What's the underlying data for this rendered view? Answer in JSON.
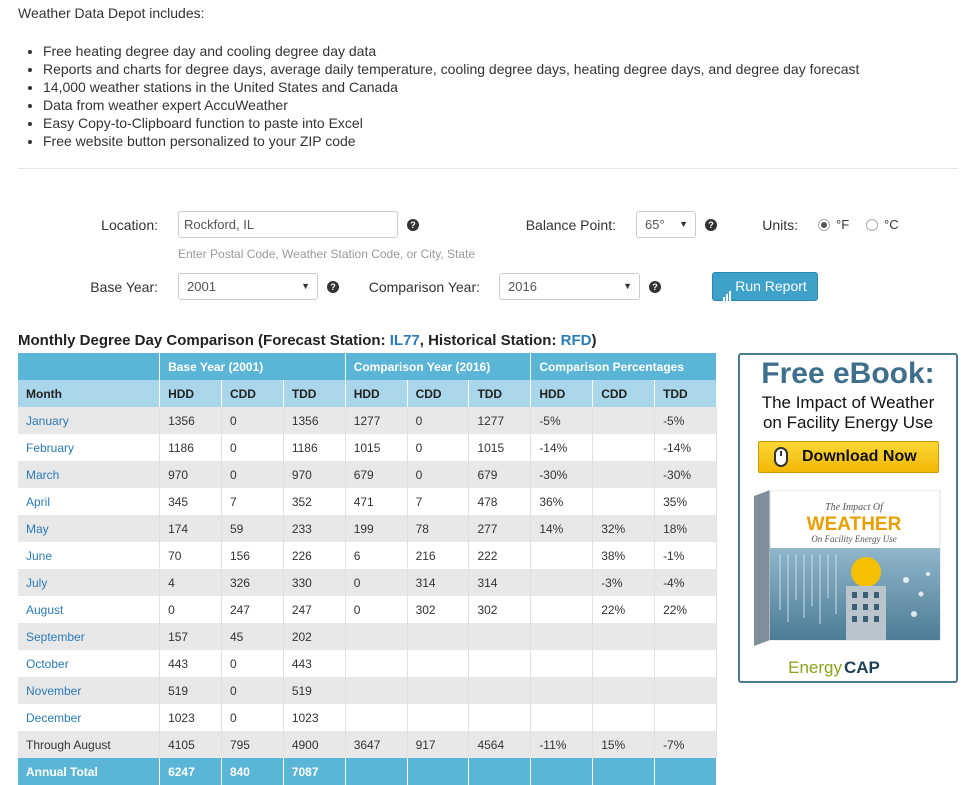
{
  "intro": {
    "title": "Weather Data Depot includes:",
    "bullets": [
      "Free heating degree day and cooling degree day data",
      "Reports and charts for degree days, average daily temperature, cooling degree days, heating degree days, and degree day forecast",
      "14,000 weather stations in the United States and Canada",
      "Data from weather expert AccuWeather",
      "Easy Copy-to-Clipboard function to paste into Excel",
      "Free website button personalized to your ZIP code"
    ]
  },
  "form": {
    "location_label": "Location:",
    "location_value": "Rockford, IL",
    "location_hint": "Enter Postal Code, Weather Station Code, or City, State",
    "balance_label": "Balance Point:",
    "balance_value": "65°",
    "units_label": "Units:",
    "unit_f": "°F",
    "unit_c": "°C",
    "base_year_label": "Base Year:",
    "base_year_value": "2001",
    "comparison_year_label": "Comparison Year:",
    "comparison_year_value": "2016",
    "run_button": "Run Report",
    "help_glyph": "?",
    "caret_glyph": "▼"
  },
  "report": {
    "title_prefix": "Monthly Degree Day Comparison (Forecast Station: ",
    "forecast_station": "IL77",
    "title_mid": ", Historical Station: ",
    "historical_station": "RFD",
    "title_suffix": ")",
    "group_headers": [
      "Base Year (2001)",
      "Comparison Year (2016)",
      "Comparison Percentages"
    ],
    "month_header": "Month",
    "sub_headers": [
      "HDD",
      "CDD",
      "TDD",
      "HDD",
      "CDD",
      "TDD",
      "HDD",
      "CDD",
      "TDD"
    ],
    "rows": [
      [
        "January",
        "1356",
        "0",
        "1356",
        "1277",
        "0",
        "1277",
        "-5%",
        "",
        "-5%"
      ],
      [
        "February",
        "1186",
        "0",
        "1186",
        "1015",
        "0",
        "1015",
        "-14%",
        "",
        "-14%"
      ],
      [
        "March",
        "970",
        "0",
        "970",
        "679",
        "0",
        "679",
        "-30%",
        "",
        "-30%"
      ],
      [
        "April",
        "345",
        "7",
        "352",
        "471",
        "7",
        "478",
        "36%",
        "",
        "35%"
      ],
      [
        "May",
        "174",
        "59",
        "233",
        "199",
        "78",
        "277",
        "14%",
        "32%",
        "18%"
      ],
      [
        "June",
        "70",
        "156",
        "226",
        "6",
        "216",
        "222",
        "",
        "38%",
        "-1%"
      ],
      [
        "July",
        "4",
        "326",
        "330",
        "0",
        "314",
        "314",
        "",
        "-3%",
        "-4%"
      ],
      [
        "August",
        "0",
        "247",
        "247",
        "0",
        "302",
        "302",
        "",
        "22%",
        "22%"
      ],
      [
        "September",
        "157",
        "45",
        "202",
        "",
        "",
        "",
        "",
        "",
        ""
      ],
      [
        "October",
        "443",
        "0",
        "443",
        "",
        "",
        "",
        "",
        "",
        ""
      ],
      [
        "November",
        "519",
        "0",
        "519",
        "",
        "",
        "",
        "",
        "",
        ""
      ],
      [
        "December",
        "1023",
        "0",
        "1023",
        "",
        "",
        "",
        "",
        "",
        ""
      ]
    ],
    "through": [
      "Through August",
      "4105",
      "795",
      "4900",
      "3647",
      "917",
      "4564",
      "-11%",
      "15%",
      "-7%"
    ],
    "total": [
      "Annual Total",
      "6247",
      "840",
      "7087",
      "",
      "",
      "",
      "",
      "",
      ""
    ]
  },
  "ad": {
    "title": "Free eBook:",
    "subtitle_line1": "The Impact of Weather",
    "subtitle_line2": "on Facility Energy Use",
    "button": "Download Now",
    "book_title_small": "The Impact Of",
    "book_title_big": "WEATHER",
    "book_title_sub": "On Facility Energy Use",
    "brand_a": "Energy",
    "brand_b": "CAP"
  },
  "colors": {
    "header_blue": "#5bb5d6",
    "subheader_blue": "#a9d6ea",
    "link_blue": "#2a7ab8",
    "button_blue": "#3da1c9",
    "ad_button_yellow": "#f2b705"
  }
}
